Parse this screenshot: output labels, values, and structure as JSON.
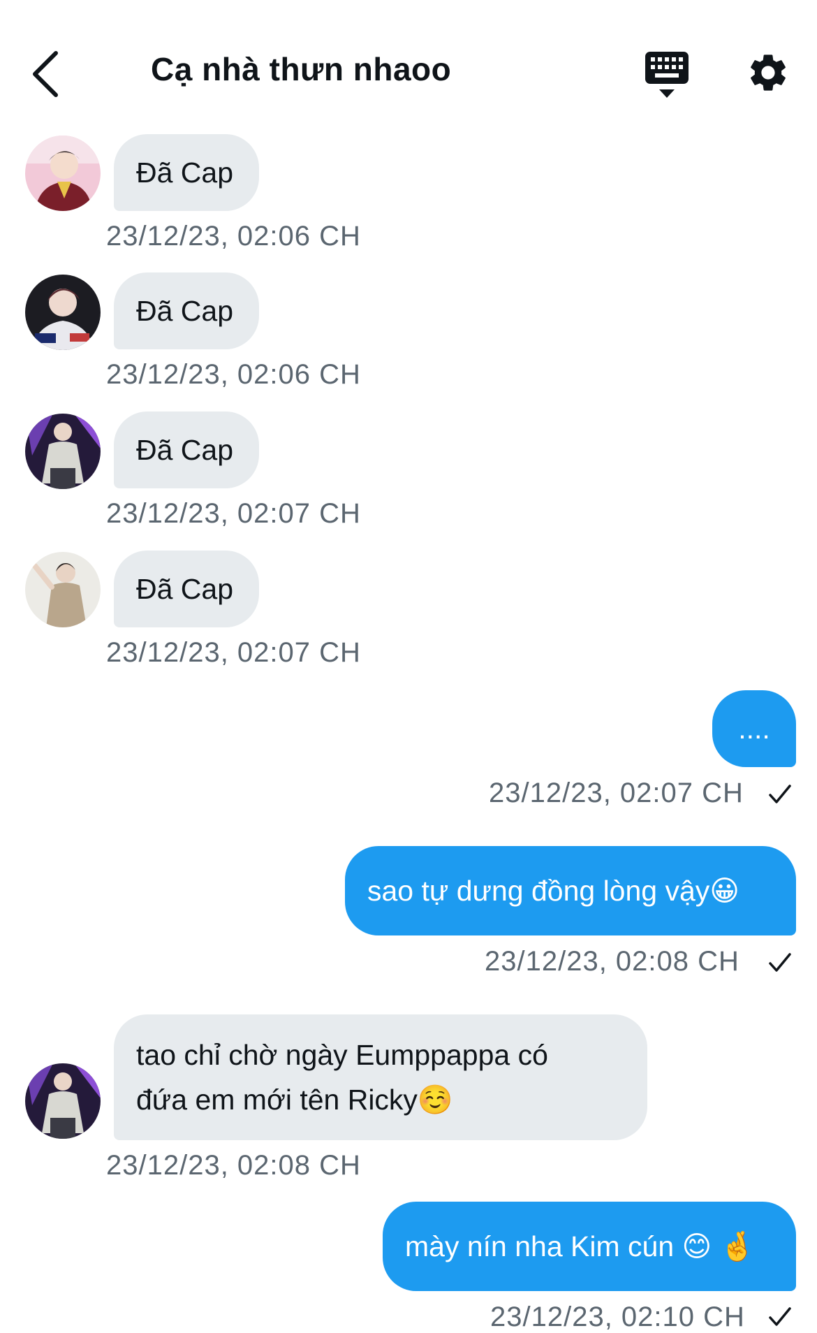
{
  "header": {
    "title": "Cạ nhà thưn nhaoo",
    "back_icon": "chevron-left-icon",
    "keyboard_icon": "keyboard-icon",
    "settings_icon": "gear-icon"
  },
  "colors": {
    "incoming_bubble": "#e7ebee",
    "outgoing_bubble": "#1d9bf0",
    "timestamp": "#5b6670"
  },
  "messages": [
    {
      "direction": "in",
      "avatar": "avatar-1",
      "text": "Đã Cap",
      "time": "23/12/23, 02:06 CH"
    },
    {
      "direction": "in",
      "avatar": "avatar-2",
      "text": "Đã Cap",
      "time": "23/12/23, 02:06 CH"
    },
    {
      "direction": "in",
      "avatar": "avatar-3",
      "text": "Đã Cap",
      "time": "23/12/23, 02:07 CH"
    },
    {
      "direction": "in",
      "avatar": "avatar-4",
      "text": "Đã Cap",
      "time": "23/12/23, 02:07 CH"
    },
    {
      "direction": "out",
      "text": "....",
      "time": "23/12/23, 02:07 CH",
      "status": "sent"
    },
    {
      "direction": "out",
      "text": "sao tự dưng đồng lòng vậy😀",
      "time": "23/12/23, 02:08 CH",
      "status": "sent"
    },
    {
      "direction": "in",
      "avatar": "avatar-3",
      "text_line1": "tao chỉ chờ ngày Eumppappa có",
      "text_line2": "đứa em mới tên Ricky☺️",
      "time": "23/12/23, 02:08 CH"
    },
    {
      "direction": "out",
      "text": "mày nín nha Kim cún 😊 🤞",
      "time": "23/12/23, 02:10 CH",
      "status": "sent"
    }
  ]
}
